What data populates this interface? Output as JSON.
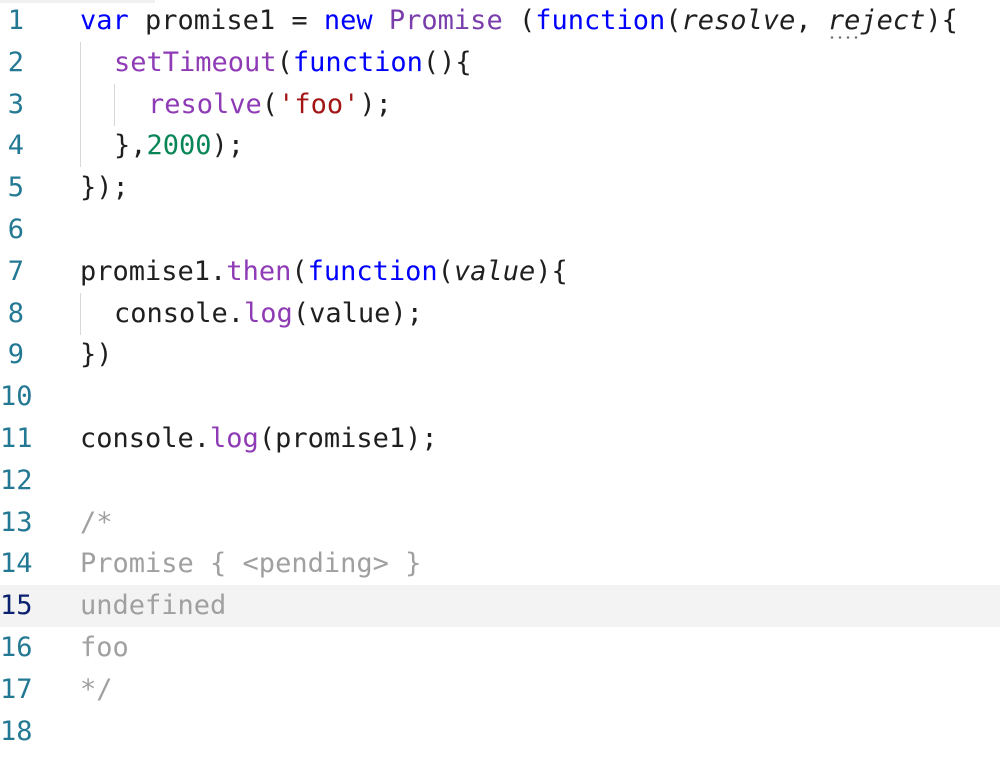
{
  "editor": {
    "current_line": 15,
    "lines": [
      {
        "number": "1",
        "tokens": [
          {
            "text": "var",
            "kind": "kw"
          },
          {
            "text": " promise1 = ",
            "kind": "plain"
          },
          {
            "text": "new",
            "kind": "kw"
          },
          {
            "text": " ",
            "kind": "plain"
          },
          {
            "text": "Promise",
            "kind": "cls"
          },
          {
            "text": " (",
            "kind": "plain"
          },
          {
            "text": "function",
            "kind": "kw"
          },
          {
            "text": "(",
            "kind": "plain"
          },
          {
            "text": "resolve",
            "kind": "param"
          },
          {
            "text": ", ",
            "kind": "plain"
          },
          {
            "text": "reject",
            "kind": "param-dots"
          },
          {
            "text": "){",
            "kind": "plain"
          }
        ]
      },
      {
        "number": "2",
        "indent": 1,
        "tokens": [
          {
            "text": "setTimeout",
            "kind": "purple"
          },
          {
            "text": "(",
            "kind": "plain"
          },
          {
            "text": "function",
            "kind": "kw"
          },
          {
            "text": "(){",
            "kind": "plain"
          }
        ]
      },
      {
        "number": "3",
        "indent": 2,
        "tokens": [
          {
            "text": "resolve",
            "kind": "purple"
          },
          {
            "text": "(",
            "kind": "plain"
          },
          {
            "text": "'foo'",
            "kind": "str"
          },
          {
            "text": ");",
            "kind": "plain"
          }
        ]
      },
      {
        "number": "4",
        "indent": 1,
        "tokens": [
          {
            "text": "},",
            "kind": "plain"
          },
          {
            "text": "2000",
            "kind": "num"
          },
          {
            "text": ");",
            "kind": "plain"
          }
        ]
      },
      {
        "number": "5",
        "tokens": [
          {
            "text": "});",
            "kind": "plain"
          }
        ]
      },
      {
        "number": "6",
        "tokens": []
      },
      {
        "number": "7",
        "tokens": [
          {
            "text": "promise1.",
            "kind": "plain"
          },
          {
            "text": "then",
            "kind": "purple"
          },
          {
            "text": "(",
            "kind": "plain"
          },
          {
            "text": "function",
            "kind": "kw"
          },
          {
            "text": "(",
            "kind": "plain"
          },
          {
            "text": "value",
            "kind": "param"
          },
          {
            "text": "){",
            "kind": "plain"
          }
        ]
      },
      {
        "number": "8",
        "indent": 1,
        "tokens": [
          {
            "text": "console.",
            "kind": "plain"
          },
          {
            "text": "log",
            "kind": "purple"
          },
          {
            "text": "(value);",
            "kind": "plain"
          }
        ]
      },
      {
        "number": "9",
        "tokens": [
          {
            "text": "})",
            "kind": "plain"
          }
        ]
      },
      {
        "number": "10",
        "tokens": []
      },
      {
        "number": "11",
        "tokens": [
          {
            "text": "console.",
            "kind": "plain"
          },
          {
            "text": "log",
            "kind": "purple"
          },
          {
            "text": "(promise1);",
            "kind": "plain"
          }
        ]
      },
      {
        "number": "12",
        "tokens": []
      },
      {
        "number": "13",
        "tokens": [
          {
            "text": "/*",
            "kind": "cm"
          }
        ]
      },
      {
        "number": "14",
        "tokens": [
          {
            "text": "Promise { <pending> }",
            "kind": "cm"
          }
        ]
      },
      {
        "number": "15",
        "tokens": [
          {
            "text": "undefined",
            "kind": "cm"
          }
        ]
      },
      {
        "number": "16",
        "tokens": [
          {
            "text": "foo",
            "kind": "cm"
          }
        ]
      },
      {
        "number": "17",
        "tokens": [
          {
            "text": "*/",
            "kind": "cm"
          }
        ]
      },
      {
        "number": "18",
        "tokens": []
      }
    ]
  },
  "colors": {
    "keyword": "#0000ff",
    "method": "#8e3bb5",
    "class": "#7a3eab",
    "string": "#a31515",
    "number": "#098658",
    "comment": "#a0a0a0",
    "line_number": "#237893",
    "current_line_number": "#0b216f",
    "current_line_background": "#f3f3f3"
  }
}
